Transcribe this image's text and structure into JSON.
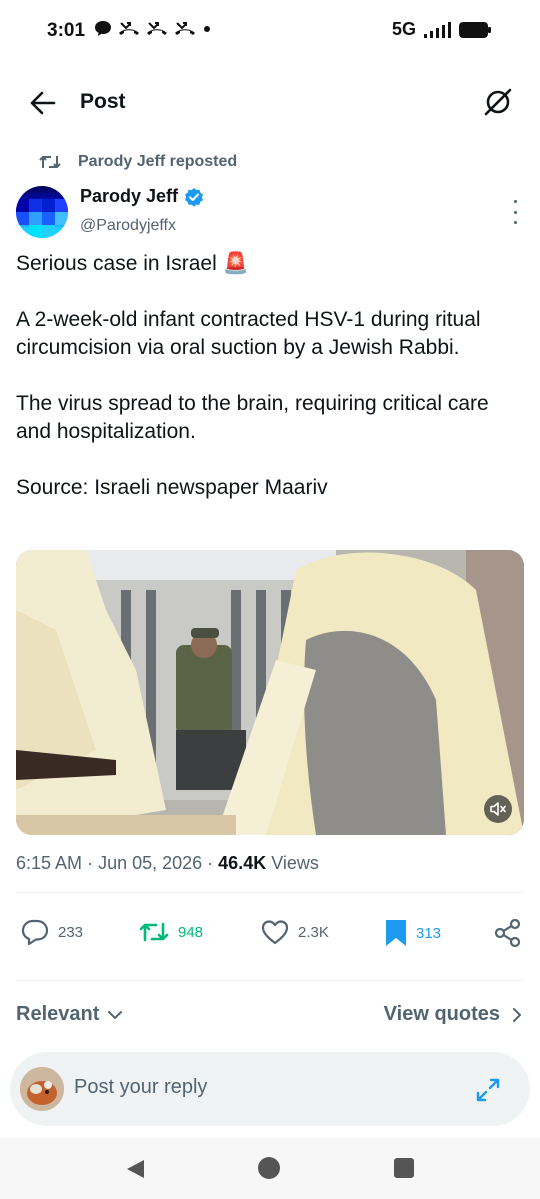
{
  "status_bar": {
    "time": "3:01",
    "left_icons": [
      "chat-bubble-icon",
      "missed-call-icon",
      "missed-call-icon",
      "missed-call-icon",
      "dot-icon"
    ],
    "network": "5G",
    "signal_icon": "signal-bars-icon",
    "battery_icon": "battery-icon"
  },
  "header": {
    "title": "Post",
    "back_icon": "arrow-left-icon",
    "grok_icon": "grok-icon"
  },
  "post": {
    "repost_label": "Parody Jeff reposted",
    "author_name": "Parody Jeff",
    "author_handle": "@Parodyjeffx",
    "verified": true,
    "text_line1": "Serious case in Israel 🚨",
    "text_para2": "A 2-week-old infant contracted HSV-1 during ritual circumcision via oral suction by a Jewish Rabbi.",
    "text_para3": "The virus spread to the brain, requiring critical care and hospitalization.",
    "text_para4": "Source: Israeli newspaper Maariv",
    "time": "6:15 AM",
    "date": "Jun 05, 2026",
    "views_count": "46.4K",
    "views_label": "Views"
  },
  "actions": {
    "replies": "233",
    "reposts": "948",
    "likes": "2.3K",
    "bookmarks": "313"
  },
  "replies_filter": {
    "sort_label": "Relevant",
    "view_quotes_label": "View quotes"
  },
  "reply_box": {
    "placeholder": "Post your reply"
  },
  "colors": {
    "text_primary": "#0f1419",
    "text_secondary": "#536471",
    "accent_blue": "#1d9bf0",
    "repost_green": "#00ba7c",
    "divider": "#eff3f4"
  }
}
